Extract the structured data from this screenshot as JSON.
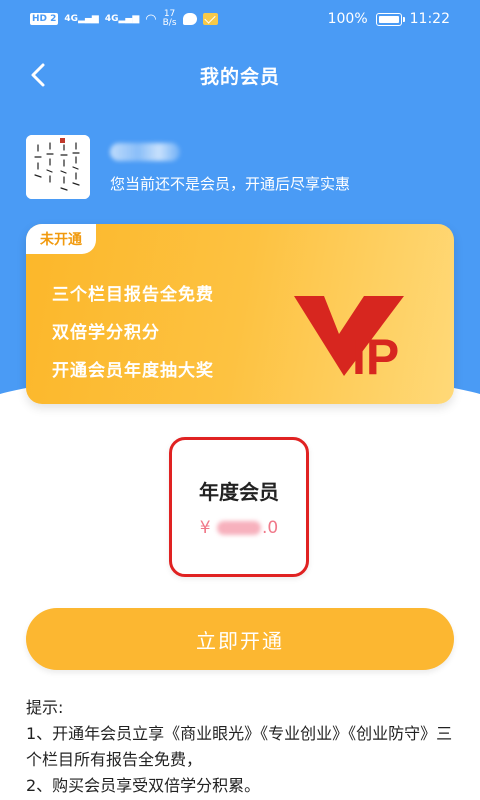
{
  "status_bar": {
    "hd_label": "HD",
    "hd_sim": "2",
    "signal1": "4G",
    "signal2": "4G",
    "net_speed_value": "17",
    "net_speed_unit": "B/s",
    "battery": "100%",
    "time": "11:22"
  },
  "nav": {
    "title": "我的会员"
  },
  "user": {
    "hint": "您当前还不是会员，开通后尽享实惠"
  },
  "vip_card": {
    "badge": "未开通",
    "benefits": [
      "三个栏目报告全免费",
      "双倍学分积分",
      "开通会员年度抽大奖"
    ],
    "logo_text_a": "V",
    "logo_text_b": "IP"
  },
  "plan": {
    "name": "年度会员",
    "currency": "¥",
    "price_suffix": ".0"
  },
  "open_button": "立即开通",
  "tips": {
    "heading": "提示:",
    "line1": "1、开通年会员立享《商业眼光》《专业创业》《创业防守》三个栏目所有报告全免费，",
    "line2": "2、购买会员享受双倍学分积累。"
  },
  "colors": {
    "header_blue": "#4a9bf5",
    "vip_gold": "#fcb72a",
    "plan_border": "#e02222",
    "button_gold": "#fcb731"
  }
}
